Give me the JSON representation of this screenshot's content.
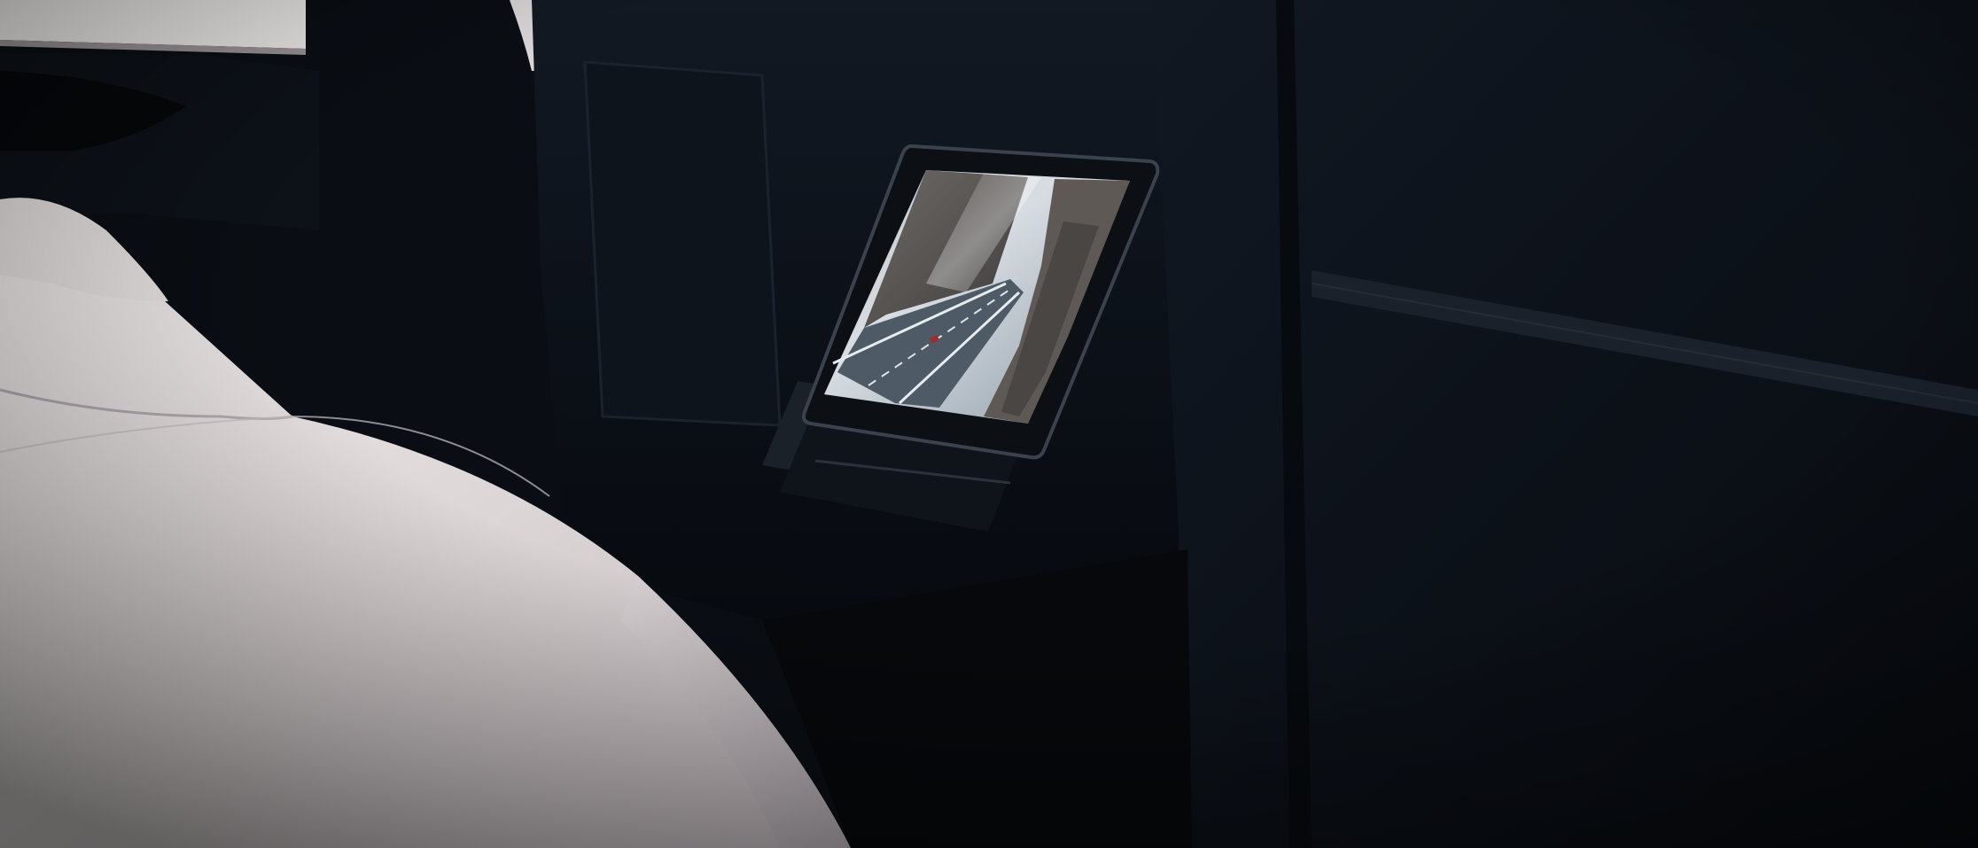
{
  "scene": {
    "description_colors": {
      "cabin_dark": "#0b0f15",
      "seat_leather": "#e6e0df",
      "headliner": "#f1efee",
      "screen_sky": "#cfd6dd",
      "road": "#5b6a78"
    },
    "icons": [
      "rear-touchscreen",
      "seat",
      "headrest"
    ]
  }
}
